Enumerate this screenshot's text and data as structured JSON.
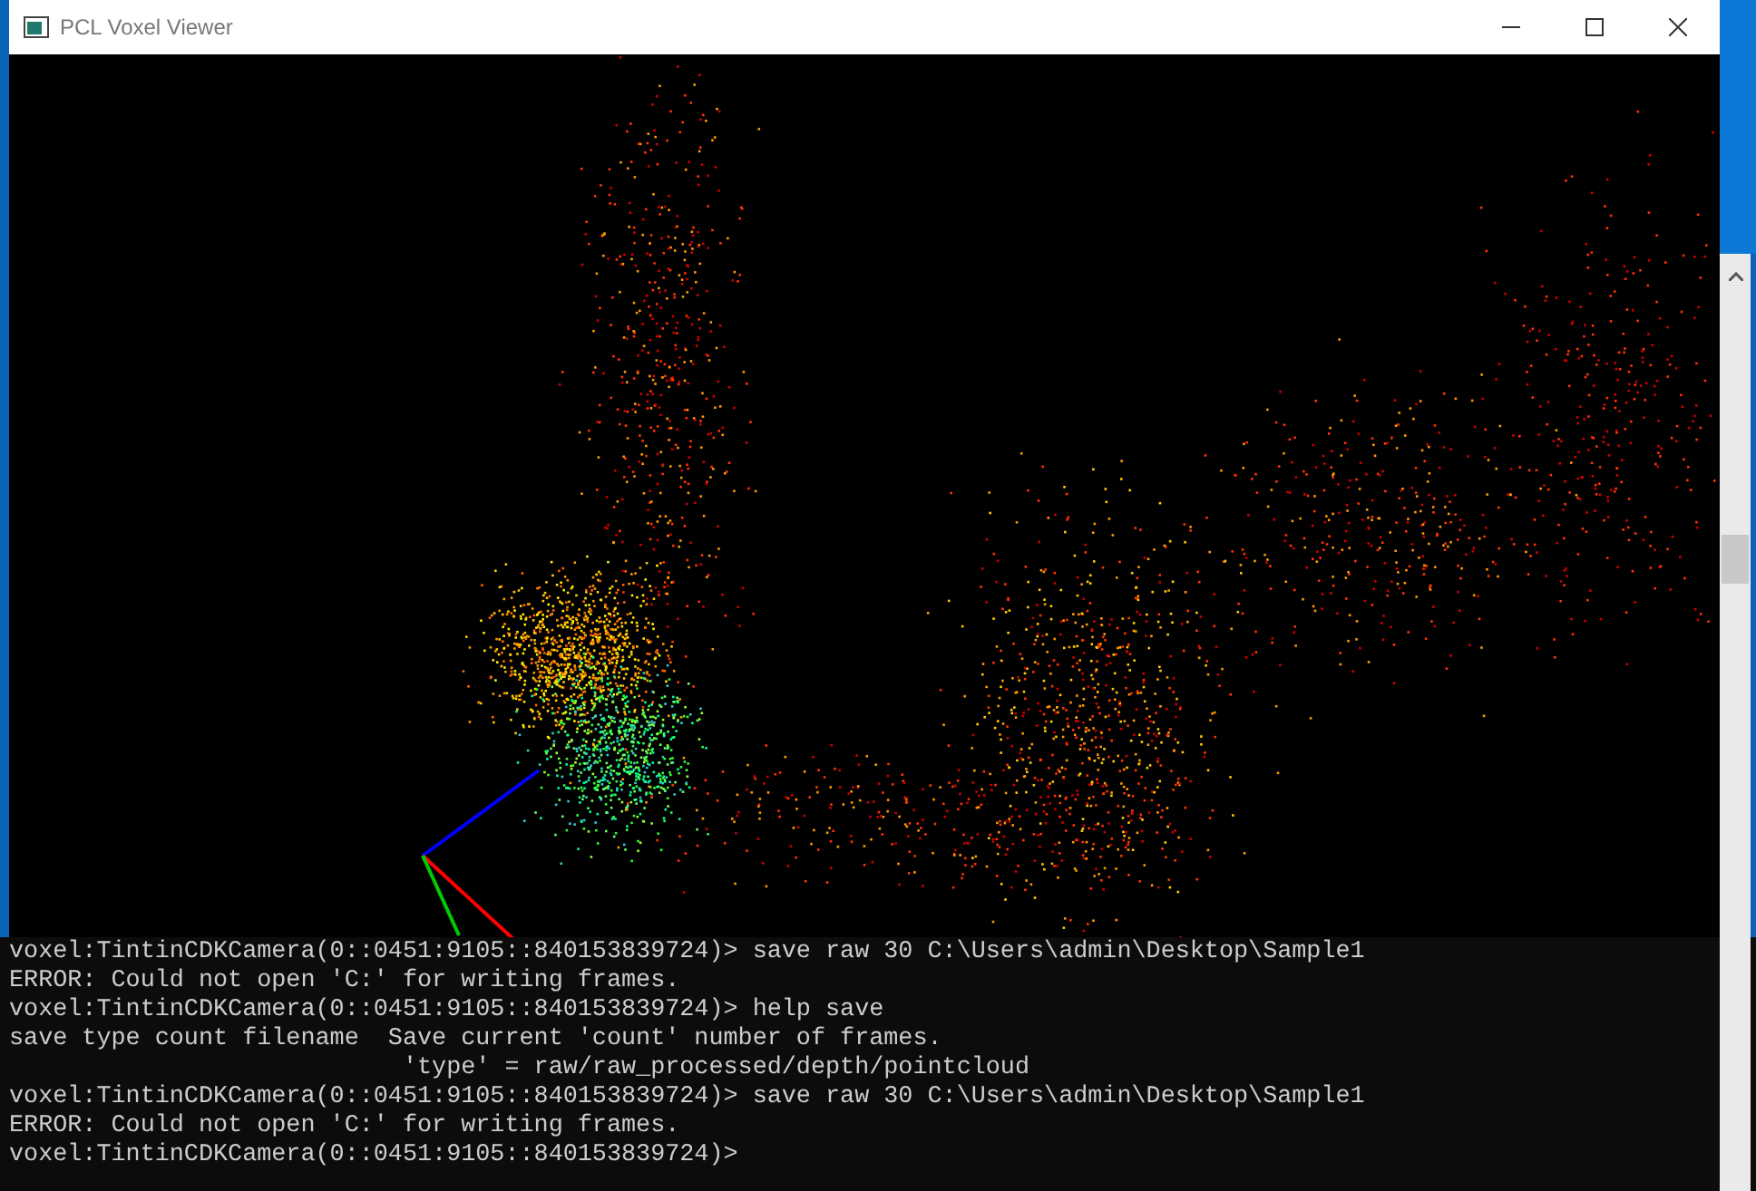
{
  "window": {
    "title": "PCL Voxel Viewer"
  },
  "console": {
    "lines": [
      "voxel:TintinCDKCamera(0::0451:9105::840153839724)> save raw 30 C:\\Users\\admin\\Desktop\\Sample1",
      "ERROR: Could not open 'C:' for writing frames.",
      "voxel:TintinCDKCamera(0::0451:9105::840153839724)> help save",
      "save type count filename  Save current 'count' number of frames.",
      "                           'type' = raw/raw_processed/depth/pointcloud",
      "voxel:TintinCDKCamera(0::0451:9105::840153839724)> save raw 30 C:\\Users\\admin\\Desktop\\Sample1",
      "ERROR: Could not open 'C:' for writing frames.",
      "voxel:TintinCDKCamera(0::0451:9105::840153839724)>"
    ]
  }
}
